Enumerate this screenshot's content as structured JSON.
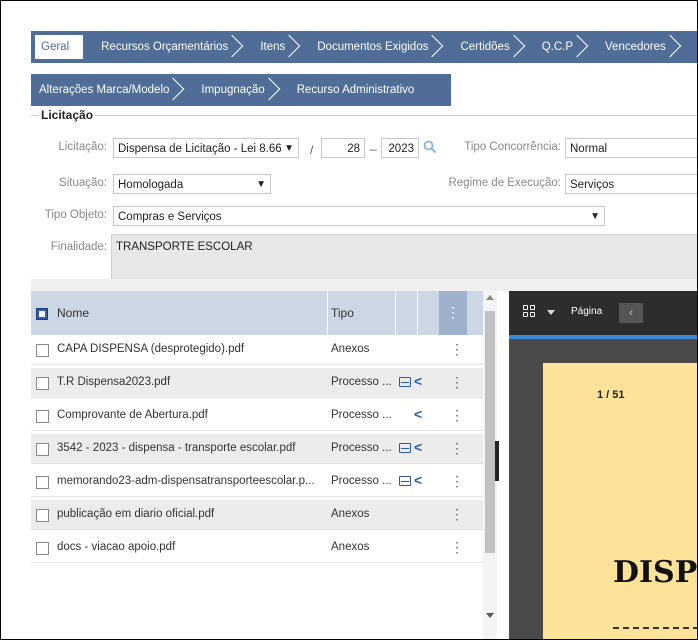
{
  "tabs_row1": [
    "Geral",
    "Recursos Orçamentários",
    "Itens",
    "Documentos Exigidos",
    "Certidões",
    "Q.C.P",
    "Vencedores",
    "C"
  ],
  "tabs_row2": [
    "Alterações Marca/Modelo",
    "Impugnação",
    "Recurso Administrativo"
  ],
  "section": {
    "title": "Licitação",
    "licitacao_label": "Licitação:",
    "licitacao_value": "Dispensa de Licitação - Lei 8.66",
    "licitacao_number": "28",
    "licitacao_year": "2023",
    "slash": "/",
    "dash": "_",
    "tipo_concorrencia_label": "Tipo Concorrência:",
    "tipo_concorrencia_value": "Normal",
    "situacao_label": "Situação:",
    "situacao_value": "Homologada",
    "regime_label": "Regime de Execução:",
    "regime_value": "Serviços",
    "tipo_objeto_label": "Tipo Objeto:",
    "tipo_objeto_value": "Compras e Serviços",
    "finalidade_label": "Finalidade:",
    "finalidade_value": "TRANSPORTE ESCOLAR"
  },
  "list": {
    "col_nome": "Nome",
    "col_tipo": "Tipo",
    "rows": [
      {
        "nome": "CAPA DISPENSA (desprotegido).pdf",
        "tipo": "Anexos",
        "doc": false,
        "share": false
      },
      {
        "nome": "T.R Dispensa2023.pdf",
        "tipo": "Processo ...",
        "doc": true,
        "share": true
      },
      {
        "nome": "Comprovante de Abertura.pdf",
        "tipo": "Processo ...",
        "doc": false,
        "share": true
      },
      {
        "nome": "3542 - 2023 - dispensa - transporte escolar.pdf",
        "tipo": "Processo ...",
        "doc": true,
        "share": true
      },
      {
        "nome": "memorando23-adm-dispensatransporteescolar.p...",
        "tipo": "Processo ...",
        "doc": true,
        "share": true
      },
      {
        "nome": "publicação em diario oficial.pdf",
        "tipo": "Anexos",
        "doc": false,
        "share": false
      },
      {
        "nome": "docs - viacao apoio.pdf",
        "tipo": "Anexos",
        "doc": false,
        "share": false
      }
    ]
  },
  "viewer": {
    "page_label": "Página",
    "prev": "‹",
    "page_indicator": "1 / 51",
    "big_text": "DISP"
  }
}
